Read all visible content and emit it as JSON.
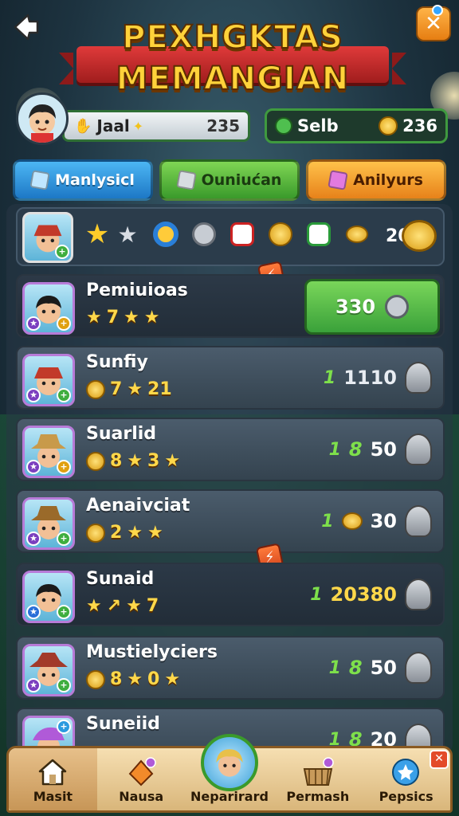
{
  "title": {
    "line1": "PEXHGKTAS",
    "line2": "MEMANGIAN"
  },
  "player": {
    "name": "Jaal",
    "score": "235"
  },
  "currency": {
    "label": "Selb",
    "amount": "236"
  },
  "tabs": [
    {
      "label": "Manlysicl",
      "color": "#1d78c6"
    },
    {
      "label": "Ouniućan",
      "color": "#3a9a2b"
    },
    {
      "label": "Anilyurs",
      "color": "#e7821a"
    }
  ],
  "reward_row": {
    "count": "20"
  },
  "rows": [
    {
      "name": "Pemiuioas",
      "stat_a": "7",
      "stat_b": "",
      "right_num": "330",
      "claim": true
    },
    {
      "name": "Sunfiy",
      "stat_a": "7",
      "stat_b": "21",
      "rank": "1",
      "right_num": "1110"
    },
    {
      "name": "Suarlid",
      "stat_a": "8",
      "stat_b": "3",
      "rank": "1",
      "mid": "8",
      "right_num": "50"
    },
    {
      "name": "Aenaivciat",
      "stat_a": "2",
      "stat_b": "",
      "rank": "1",
      "right_num": "30"
    },
    {
      "name": "Sunaid",
      "stat_a": "",
      "stat_b": "7",
      "rank": "1",
      "right_num": "20380"
    },
    {
      "name": "Mustielyciers",
      "stat_a": "8",
      "stat_b": "0",
      "rank": "1",
      "mid": "8",
      "right_num": "50"
    },
    {
      "name": "Suneiid",
      "stat_a": "",
      "stat_b": "",
      "rank": "1",
      "mid": "8",
      "right_num": "20"
    }
  ],
  "nav": [
    {
      "label": "Masit"
    },
    {
      "label": "Nausa"
    },
    {
      "label": "Neparirard"
    },
    {
      "label": "Permash"
    },
    {
      "label": "Pepsics"
    }
  ]
}
